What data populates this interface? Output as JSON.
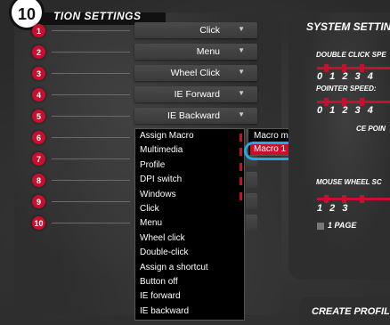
{
  "section": {
    "badge": "10",
    "title": "TION SETTINGS"
  },
  "rows": [
    {
      "num": "1",
      "value": "Click"
    },
    {
      "num": "2",
      "value": "Menu"
    },
    {
      "num": "3",
      "value": "Wheel Click"
    },
    {
      "num": "4",
      "value": "IE Forward"
    },
    {
      "num": "5",
      "value": "IE Backward"
    },
    {
      "num": "6"
    },
    {
      "num": "7"
    },
    {
      "num": "8"
    },
    {
      "num": "9"
    },
    {
      "num": "10"
    }
  ],
  "dropdown_arrow": "▼",
  "menu": {
    "items": [
      {
        "label": "Assign Macro",
        "has_submenu": true
      },
      {
        "label": "Multimedia",
        "has_submenu": true
      },
      {
        "label": "Profile",
        "has_submenu": true
      },
      {
        "label": "DPI switch",
        "has_submenu": true
      },
      {
        "label": "Windows",
        "has_submenu": true
      },
      {
        "label": "Click"
      },
      {
        "label": "Menu"
      },
      {
        "label": "Wheel click"
      },
      {
        "label": "Double-click"
      },
      {
        "label": "Assign a shortcut"
      },
      {
        "label": "Button off"
      },
      {
        "label": "IE forward"
      },
      {
        "label": "IE backward"
      }
    ]
  },
  "submenu": {
    "items": [
      "Macro manager",
      "Macro 1"
    ],
    "selected": "Macro 1"
  },
  "system": {
    "title": "SYSTEM SETTING",
    "double_click_label": "DOUBLE CLICK SPE",
    "double_click_nums": "0 1 2 3 4",
    "pointer_label": "POINTER SPEED:",
    "pointer_nums": "0 1 2 3 4",
    "pointer_extra": "CE POIN",
    "wheel_label": "MOUSE WHEEL SC",
    "wheel_nums": "1 2 3",
    "page_label": "1 PAGE"
  },
  "create": {
    "title": "CREATE PROFIL"
  },
  "colors": {
    "accent": "#c8102e",
    "highlight": "#29a8e0"
  }
}
